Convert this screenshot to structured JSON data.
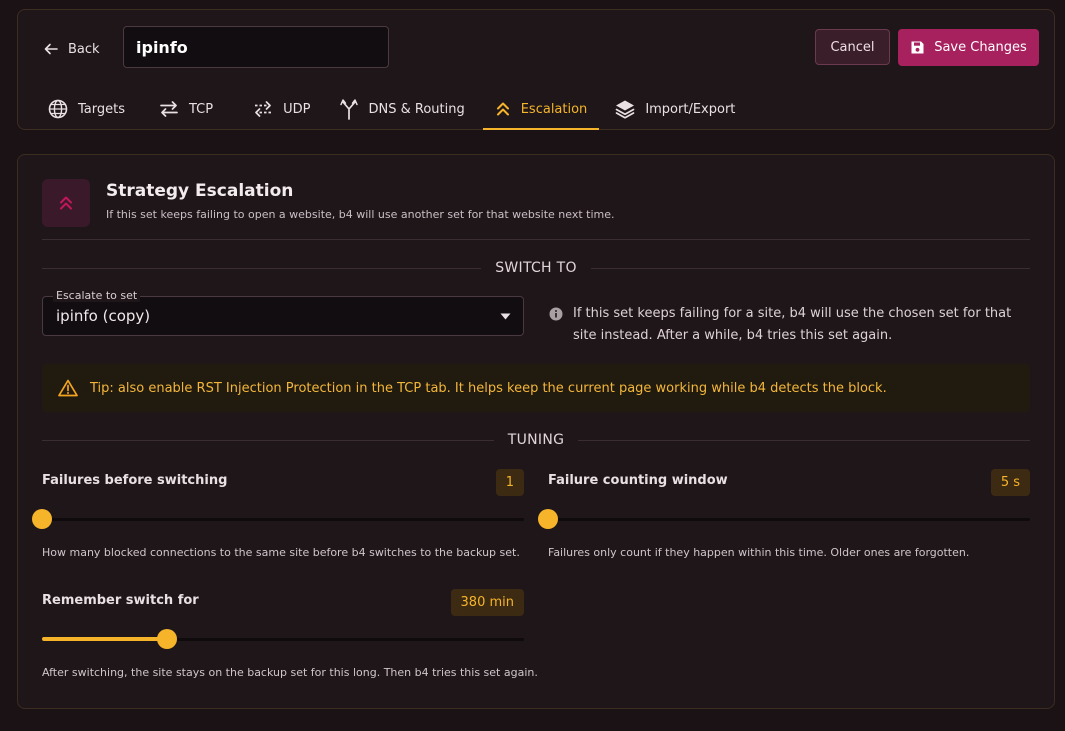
{
  "header": {
    "back_label": "Back",
    "set_name": "ipinfo",
    "cancel_label": "Cancel",
    "save_label": "Save Changes",
    "tabs": [
      {
        "label": "Targets",
        "icon": "globe-icon"
      },
      {
        "label": "TCP",
        "icon": "swap-horizontal-icon"
      },
      {
        "label": "UDP",
        "icon": "swap-dashed-icon"
      },
      {
        "label": "DNS & Routing",
        "icon": "fork-icon"
      },
      {
        "label": "Escalation",
        "icon": "chevrons-up-icon"
      },
      {
        "label": "Import/Export",
        "icon": "layers-icon"
      }
    ],
    "active_tab": "Escalation"
  },
  "section": {
    "title": "Strategy Escalation",
    "description": "If this set keeps failing to open a website, b4 will use another set for that website next time."
  },
  "switch_to": {
    "divider_label": "SWITCH TO",
    "select_label": "Escalate to set",
    "select_value": "ipinfo (copy)",
    "info_text": "If this set keeps failing for a site, b4 will use the chosen set for that site instead. After a while, b4 tries this set again."
  },
  "tip": {
    "text": "Tip: also enable RST Injection Protection in the TCP tab. It helps keep the current page working while b4 detects the block."
  },
  "tuning": {
    "divider_label": "TUNING",
    "failures": {
      "label": "Failures before switching",
      "value_display": "1",
      "fraction": 0.0,
      "help": "How many blocked connections to the same site before b4 switches to the backup set."
    },
    "window": {
      "label": "Failure counting window",
      "value_display": "5 s",
      "fraction": 0.0,
      "help": "Failures only count if they happen within this time. Older ones are forgotten."
    },
    "remember": {
      "label": "Remember switch for",
      "value_display": "380 min",
      "fraction": 0.26,
      "help": "After switching, the site stays on the backup set for this long. Then b4 tries this set again."
    }
  },
  "colors": {
    "accent": "#f5b42a",
    "primary": "#a8215f",
    "background": "#1a1215"
  }
}
